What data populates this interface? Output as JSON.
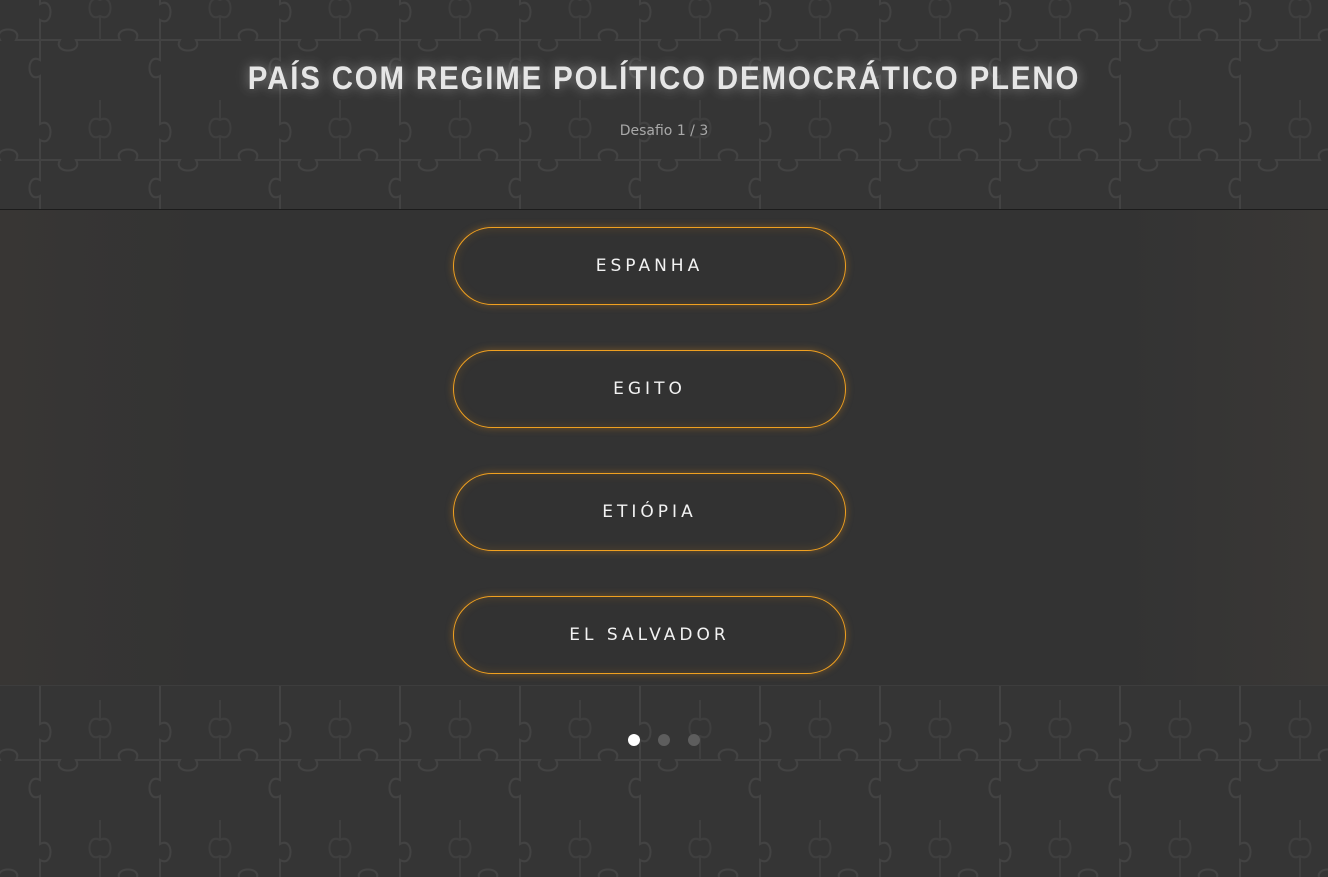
{
  "question": {
    "title": "PAÍS COM REGIME POLÍTICO DEMOCRÁTICO PLENO",
    "progress_label": "Desafio 1 / 3"
  },
  "options": [
    {
      "label": "ESPANHA"
    },
    {
      "label": "EGITO"
    },
    {
      "label": "ETIÓPIA"
    },
    {
      "label": "EL SALVADOR"
    }
  ],
  "pagination": {
    "total": 3,
    "current": 1
  },
  "colors": {
    "background": "#353535",
    "panel": "#333333",
    "accent": "#f0a020",
    "title": "#e6e6e6",
    "subtitle": "#a9a9a9",
    "dot_active": "#ffffff",
    "dot_inactive": "#5d5d5d"
  },
  "icons": {
    "background_pattern": "puzzle-pattern-icon"
  }
}
